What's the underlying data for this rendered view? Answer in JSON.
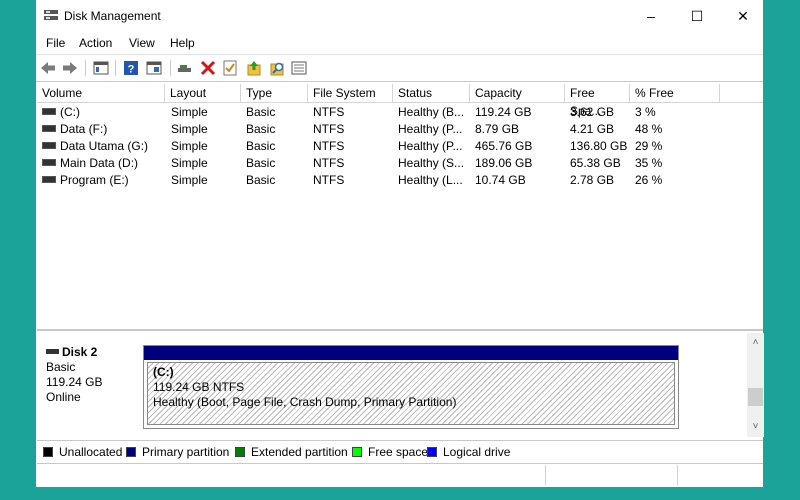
{
  "window": {
    "title": "Disk Management",
    "minimize": "–",
    "maximize": "☐",
    "close": "✕"
  },
  "menu": [
    "File",
    "Action",
    "View",
    "Help"
  ],
  "toolbar": {
    "icons": [
      "back-icon",
      "forward-icon",
      "show-hide-console-tree-icon",
      "help-icon",
      "properties-icon",
      "connect-icon",
      "delete-icon",
      "check-icon",
      "import-icon",
      "search-icon",
      "list-icon"
    ]
  },
  "list": {
    "columns": [
      "Volume",
      "Layout",
      "Type",
      "File System",
      "Status",
      "Capacity",
      "Free Spa...",
      "% Free"
    ],
    "rows": [
      {
        "volume": "(C:)",
        "layout": "Simple",
        "type": "Basic",
        "fs": "NTFS",
        "status": "Healthy (B...",
        "capacity": "119.24 GB",
        "free": "3.62 GB",
        "pct": "3 %"
      },
      {
        "volume": "Data (F:)",
        "layout": "Simple",
        "type": "Basic",
        "fs": "NTFS",
        "status": "Healthy (P...",
        "capacity": "8.79 GB",
        "free": "4.21 GB",
        "pct": "48 %"
      },
      {
        "volume": "Data Utama (G:)",
        "layout": "Simple",
        "type": "Basic",
        "fs": "NTFS",
        "status": "Healthy (P...",
        "capacity": "465.76 GB",
        "free": "136.80 GB",
        "pct": "29 %"
      },
      {
        "volume": "Main Data (D:)",
        "layout": "Simple",
        "type": "Basic",
        "fs": "NTFS",
        "status": "Healthy (S...",
        "capacity": "189.06 GB",
        "free": "65.38 GB",
        "pct": "35 %"
      },
      {
        "volume": "Program (E:)",
        "layout": "Simple",
        "type": "Basic",
        "fs": "NTFS",
        "status": "Healthy (L...",
        "capacity": "10.74 GB",
        "free": "2.78 GB",
        "pct": "26 %"
      }
    ]
  },
  "disk": {
    "name": "Disk 2",
    "type": "Basic",
    "size": "119.24 GB",
    "state": "Online",
    "partition": {
      "name": "(C:)",
      "size_fs": "119.24 GB NTFS",
      "status": "Healthy (Boot, Page File, Crash Dump, Primary Partition)"
    }
  },
  "scroll": {
    "up": "˄",
    "down": "˅"
  },
  "legend": [
    {
      "label": "Unallocated",
      "color": "#000000"
    },
    {
      "label": "Primary partition",
      "color": "#00007f"
    },
    {
      "label": "Extended partition",
      "color": "#007f00"
    },
    {
      "label": "Free space",
      "color": "#00ff00"
    },
    {
      "label": "Logical drive",
      "color": "#0000ff"
    }
  ]
}
